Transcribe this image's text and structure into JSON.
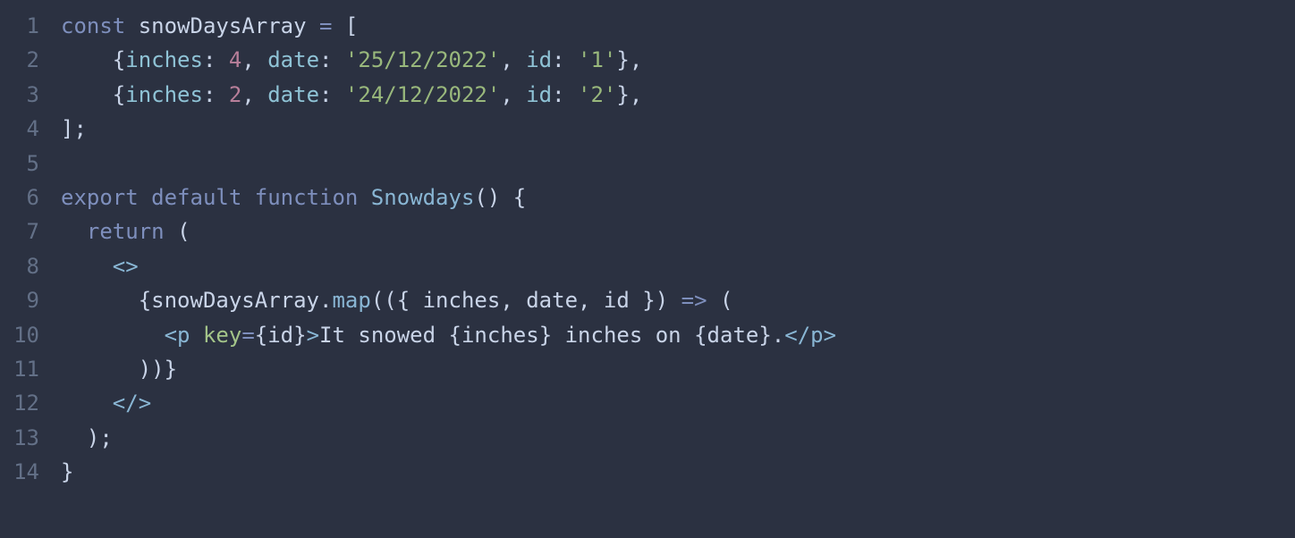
{
  "editor": {
    "lineNumbers": [
      "1",
      "2",
      "3",
      "4",
      "5",
      "6",
      "7",
      "8",
      "9",
      "10",
      "11",
      "12",
      "13",
      "14"
    ],
    "lines": [
      [
        {
          "t": "const ",
          "c": "tok-kw"
        },
        {
          "t": "snowDaysArray ",
          "c": "tok-def"
        },
        {
          "t": "= ",
          "c": "tok-op"
        },
        {
          "t": "[",
          "c": "tok-punc"
        }
      ],
      [
        {
          "t": "    {",
          "c": "tok-punc"
        },
        {
          "t": "inches",
          "c": "tok-prop"
        },
        {
          "t": ": ",
          "c": "tok-punc"
        },
        {
          "t": "4",
          "c": "tok-num"
        },
        {
          "t": ", ",
          "c": "tok-punc"
        },
        {
          "t": "date",
          "c": "tok-prop"
        },
        {
          "t": ": ",
          "c": "tok-punc"
        },
        {
          "t": "'25/12/2022'",
          "c": "tok-str"
        },
        {
          "t": ", ",
          "c": "tok-punc"
        },
        {
          "t": "id",
          "c": "tok-prop"
        },
        {
          "t": ": ",
          "c": "tok-punc"
        },
        {
          "t": "'1'",
          "c": "tok-str"
        },
        {
          "t": "},",
          "c": "tok-punc"
        }
      ],
      [
        {
          "t": "    {",
          "c": "tok-punc"
        },
        {
          "t": "inches",
          "c": "tok-prop"
        },
        {
          "t": ": ",
          "c": "tok-punc"
        },
        {
          "t": "2",
          "c": "tok-num"
        },
        {
          "t": ", ",
          "c": "tok-punc"
        },
        {
          "t": "date",
          "c": "tok-prop"
        },
        {
          "t": ": ",
          "c": "tok-punc"
        },
        {
          "t": "'24/12/2022'",
          "c": "tok-str"
        },
        {
          "t": ", ",
          "c": "tok-punc"
        },
        {
          "t": "id",
          "c": "tok-prop"
        },
        {
          "t": ": ",
          "c": "tok-punc"
        },
        {
          "t": "'2'",
          "c": "tok-str"
        },
        {
          "t": "},",
          "c": "tok-punc"
        }
      ],
      [
        {
          "t": "];",
          "c": "tok-punc"
        }
      ],
      [
        {
          "t": "",
          "c": "tok-punc"
        }
      ],
      [
        {
          "t": "export default ",
          "c": "tok-kw"
        },
        {
          "t": "function ",
          "c": "tok-kw"
        },
        {
          "t": "Snowdays",
          "c": "tok-fn"
        },
        {
          "t": "() {",
          "c": "tok-punc"
        }
      ],
      [
        {
          "t": "  ",
          "c": "tok-punc"
        },
        {
          "t": "return ",
          "c": "tok-kw"
        },
        {
          "t": "(",
          "c": "tok-punc"
        }
      ],
      [
        {
          "t": "    <>",
          "c": "tok-tag"
        }
      ],
      [
        {
          "t": "      {",
          "c": "tok-punc"
        },
        {
          "t": "snowDaysArray",
          "c": "tok-def"
        },
        {
          "t": ".",
          "c": "tok-punc"
        },
        {
          "t": "map",
          "c": "tok-fn"
        },
        {
          "t": "(({ ",
          "c": "tok-punc"
        },
        {
          "t": "inches",
          "c": "tok-def"
        },
        {
          "t": ", ",
          "c": "tok-punc"
        },
        {
          "t": "date",
          "c": "tok-def"
        },
        {
          "t": ", ",
          "c": "tok-punc"
        },
        {
          "t": "id",
          "c": "tok-def"
        },
        {
          "t": " }) ",
          "c": "tok-punc"
        },
        {
          "t": "=>",
          "c": "tok-op"
        },
        {
          "t": " (",
          "c": "tok-punc"
        }
      ],
      [
        {
          "t": "        ",
          "c": "tok-punc"
        },
        {
          "t": "<",
          "c": "tok-tag"
        },
        {
          "t": "p ",
          "c": "tok-tag"
        },
        {
          "t": "key",
          "c": "tok-attr"
        },
        {
          "t": "=",
          "c": "tok-op"
        },
        {
          "t": "{",
          "c": "tok-punc"
        },
        {
          "t": "id",
          "c": "tok-def"
        },
        {
          "t": "}",
          "c": "tok-punc"
        },
        {
          "t": ">",
          "c": "tok-tag"
        },
        {
          "t": "It snowed ",
          "c": "tok-def"
        },
        {
          "t": "{",
          "c": "tok-punc"
        },
        {
          "t": "inches",
          "c": "tok-def"
        },
        {
          "t": "}",
          "c": "tok-punc"
        },
        {
          "t": " inches on ",
          "c": "tok-def"
        },
        {
          "t": "{",
          "c": "tok-punc"
        },
        {
          "t": "date",
          "c": "tok-def"
        },
        {
          "t": "}",
          "c": "tok-punc"
        },
        {
          "t": ".",
          "c": "tok-def"
        },
        {
          "t": "</",
          "c": "tok-tag"
        },
        {
          "t": "p",
          "c": "tok-tag"
        },
        {
          "t": ">",
          "c": "tok-tag"
        }
      ],
      [
        {
          "t": "      ))}",
          "c": "tok-punc"
        }
      ],
      [
        {
          "t": "    </>",
          "c": "tok-tag"
        }
      ],
      [
        {
          "t": "  );",
          "c": "tok-punc"
        }
      ],
      [
        {
          "t": "}",
          "c": "tok-punc"
        }
      ]
    ]
  }
}
